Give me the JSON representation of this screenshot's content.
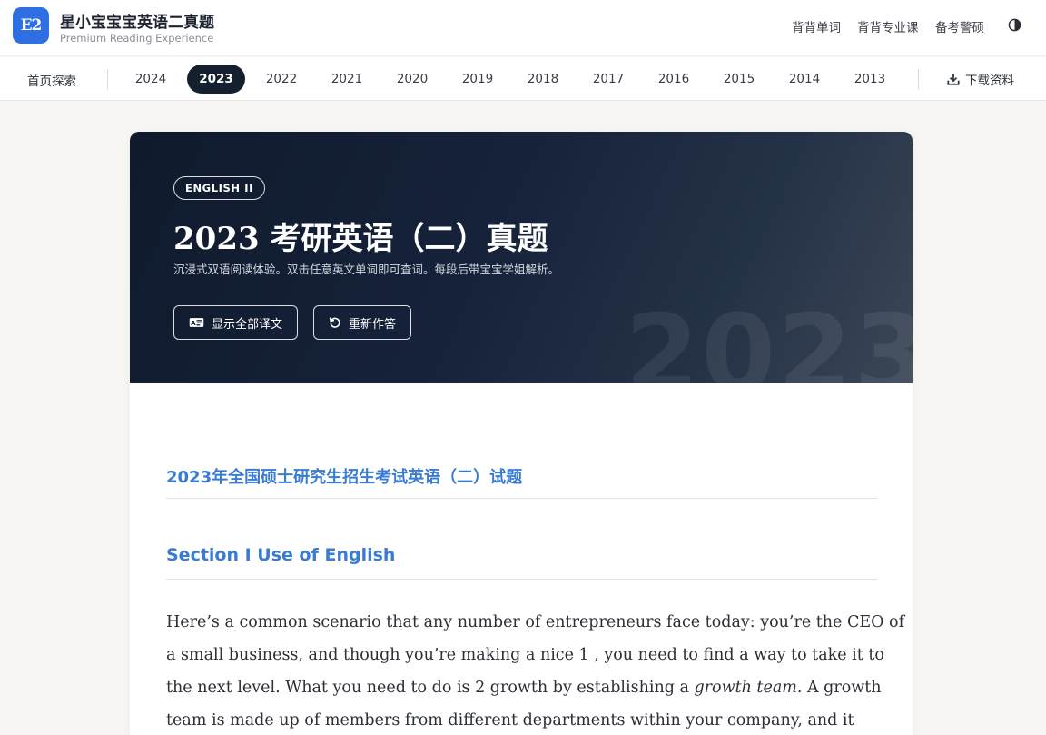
{
  "header": {
    "logo_text": "E2",
    "title": "星小宝宝宝英语二真题",
    "subtitle": "Premium Reading Experience",
    "nav": [
      "背背单词",
      "背背专业课",
      "备考警硕"
    ],
    "theme_icon": "contrast-icon"
  },
  "yearbar": {
    "home": "首页探索",
    "years": [
      "2024",
      "2023",
      "2022",
      "2021",
      "2020",
      "2019",
      "2018",
      "2017",
      "2016",
      "2015",
      "2014",
      "2013"
    ],
    "active_year": "2023",
    "download": "下载资料"
  },
  "hero": {
    "badge": "ENGLISH II",
    "title": "2023 考研英语（二）真题",
    "description": "沉浸式双语阅读体验。双击任意英文单词即可查词。每段后带宝宝学姐解析。",
    "show_translation": "显示全部译文",
    "reset": "重新作答",
    "watermark": "2023"
  },
  "content": {
    "heading": "2023年全国硕士研究生招生考试英语（二）试题",
    "section": "Section I Use of English",
    "passage_lines": [
      "Here’s a common scenario that any number of entrepreneurs face today: you’re the CEO of",
      "a small business, and though you’re making a nice 1 , you need to find a way to take it to"
    ],
    "line3_before": "the next level. What you need to do is 2 growth by establishing a ",
    "line3_italic": "growth team.",
    "line3_after": " A growth",
    "line4": "team is made up of members from different departments within your company, and it"
  },
  "colors": {
    "accent": "#2f6fe4",
    "heading_blue": "#3a7bd5",
    "active_tab": "#15202f"
  }
}
